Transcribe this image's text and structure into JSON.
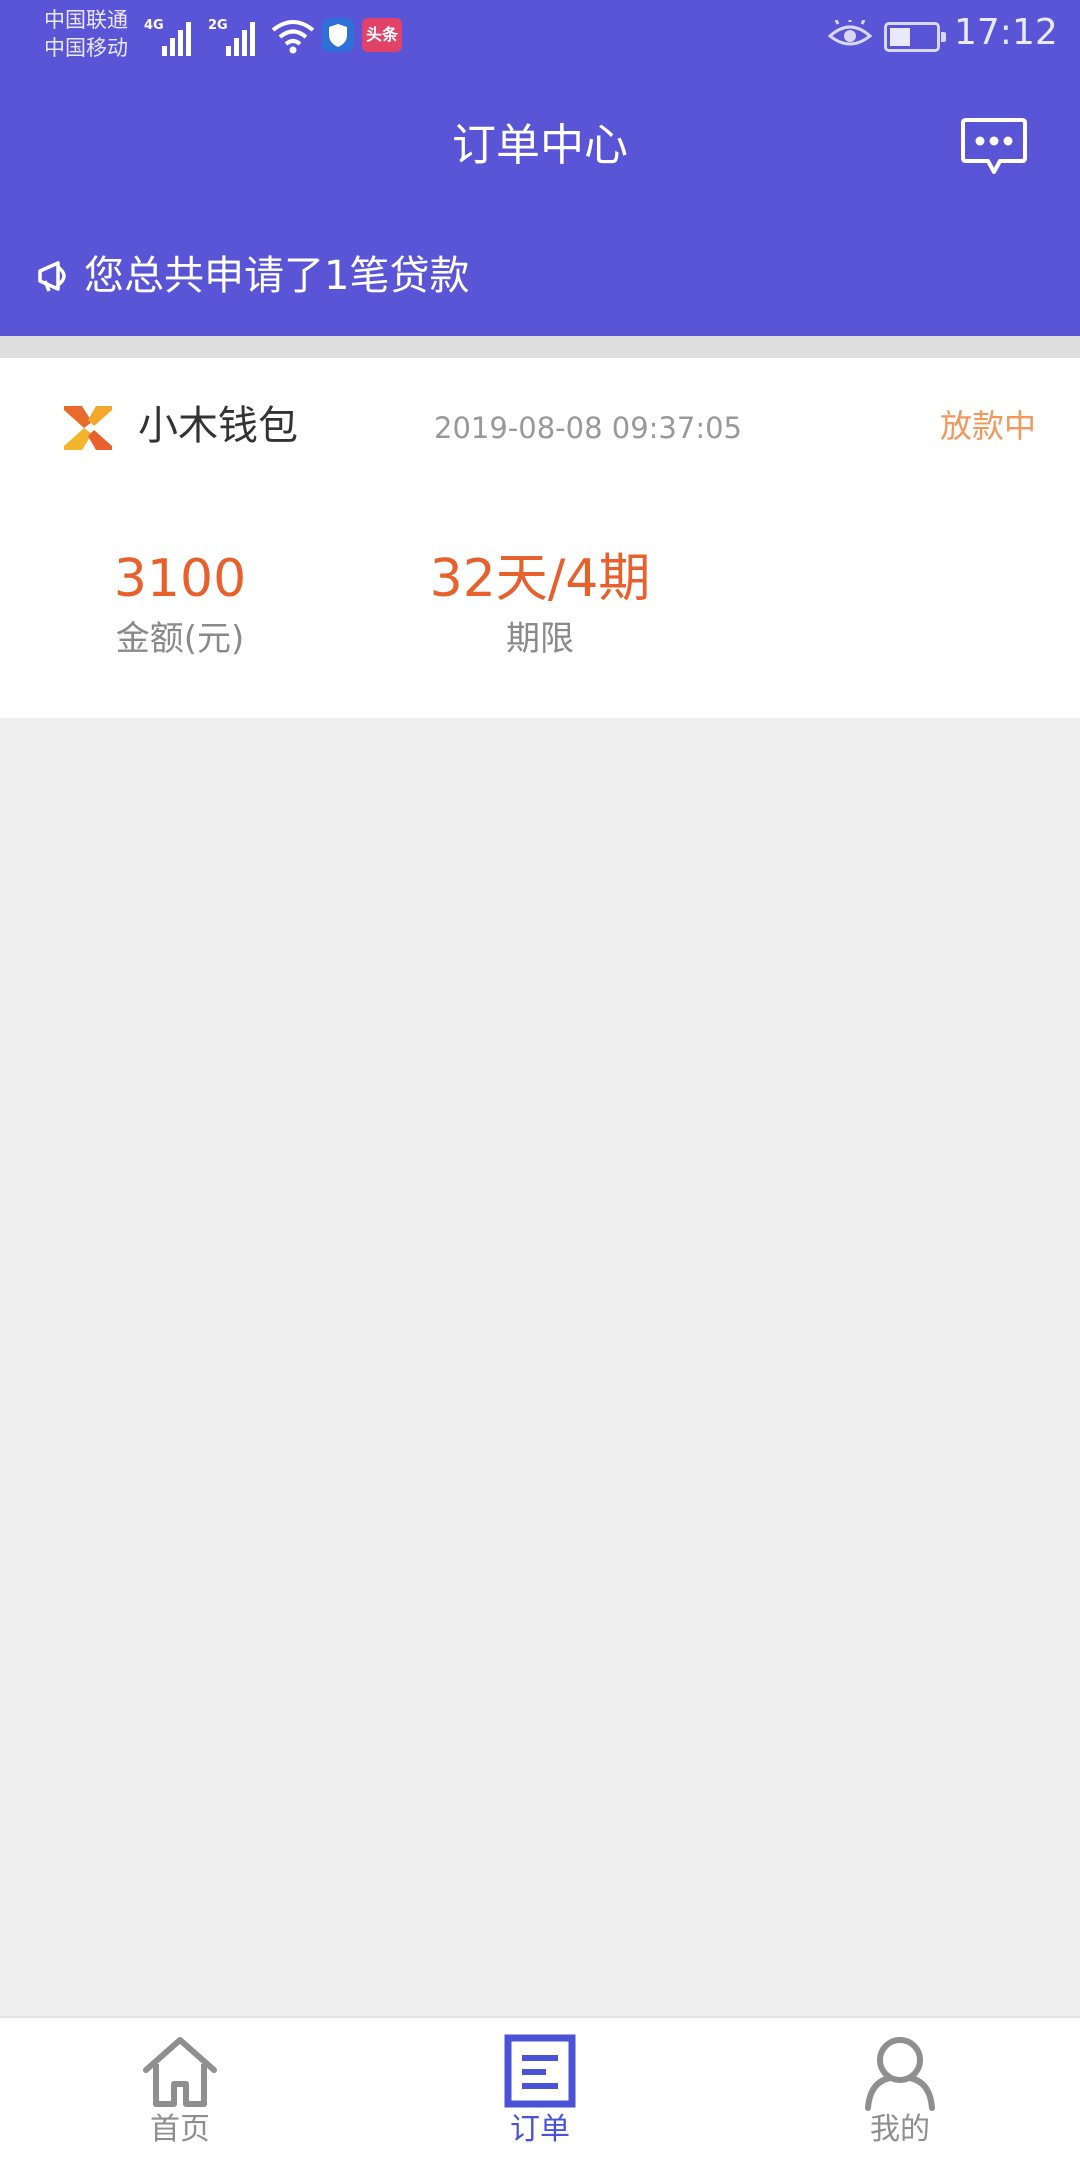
{
  "status_bar": {
    "carrier_1": "中国联通",
    "carrier_2": "中国移动",
    "network_1": "4G",
    "network_2": "2G",
    "app_badge": "头条",
    "time": "17:12"
  },
  "header": {
    "title": "订单中心",
    "message_icon": "chat-bubble-icon",
    "background_color": "#5a55d6"
  },
  "notice": {
    "icon": "megaphone-icon",
    "text": "您总共申请了1笔贷款"
  },
  "order": {
    "product_name": "小木钱包",
    "time": "2019-08-08 09:37:05",
    "status": "放款中",
    "amount_value": "3100",
    "amount_label": "金额(元)",
    "term_value": "32天/4期",
    "term_label": "期限"
  },
  "bottom_nav": {
    "items": [
      {
        "label": "首页",
        "icon": "home-icon",
        "active": false
      },
      {
        "label": "订单",
        "icon": "order-list-icon",
        "active": true
      },
      {
        "label": "我的",
        "icon": "person-icon",
        "active": false
      }
    ],
    "active_color": "#4a52d6",
    "inactive_color": "#8f8f8f"
  }
}
